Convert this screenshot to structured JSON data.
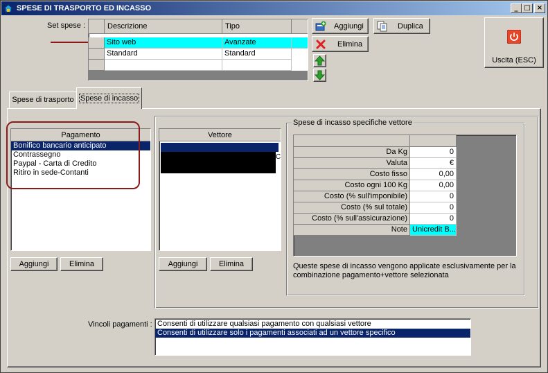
{
  "window": {
    "title": "SPESE DI TRASPORTO ED INCASSO",
    "min_label": "_",
    "max_label": "□",
    "close_label": "×"
  },
  "set_spese": {
    "label": "Set spese :",
    "columns": [
      "Descrizione",
      "Tipo"
    ],
    "rows": [
      {
        "descrizione": "Sito web",
        "tipo": "Avanzate"
      },
      {
        "descrizione": "Standard",
        "tipo": "Standard"
      },
      {
        "descrizione": "",
        "tipo": ""
      }
    ]
  },
  "toolbar": {
    "aggiungi": "Aggiungi",
    "duplica": "Duplica",
    "elimina": "Elimina",
    "uscita": "Uscita (ESC)"
  },
  "tabs": [
    {
      "label": "Spese di trasporto",
      "active": false
    },
    {
      "label": "Spese di incasso",
      "active": true
    }
  ],
  "pagamento": {
    "header": "Pagamento",
    "items": [
      "Bonifico bancario anticipato",
      "Contrassegno",
      "Paypal - Carta di Credito",
      "Ritiro in sede-Contanti"
    ],
    "selected_index": 0,
    "add_label": "Aggiungi",
    "delete_label": "Elimina"
  },
  "vettore": {
    "header": "Vettore",
    "add_label": "Aggiungi",
    "delete_label": "Elimina"
  },
  "spese_vettore": {
    "title": "Spese di incasso specifiche vettore",
    "rows": [
      {
        "label": "Da Kg",
        "value": "0"
      },
      {
        "label": "Valuta",
        "value": "€"
      },
      {
        "label": "Costo fisso",
        "value": "0,00"
      },
      {
        "label": "Costo ogni 100 Kg",
        "value": "0,00"
      },
      {
        "label": "Costo (% sull'imponibile)",
        "value": "0"
      },
      {
        "label": "Costo (% sul totale)",
        "value": "0"
      },
      {
        "label": "Costo (% sull'assicurazione)",
        "value": "0"
      },
      {
        "label": "Note",
        "value": "Unicredit B..."
      }
    ],
    "note_line1": "Queste spese di incasso vengono applicate esclusivamente per la",
    "note_line2": "combinazione pagamento+vettore selezionata"
  },
  "vincoli": {
    "label": "Vincoli pagamenti :",
    "options": [
      "Consenti di utilizzare qualsiasi pagamento con qualsiasi vettore",
      "Consenti di utilizzare solo i pagamenti associati ad un vettore specifico"
    ],
    "selected_index": 1
  },
  "colors": {
    "title_start": "#0a246a",
    "title_end": "#a6caf0",
    "selection": "#0a246a",
    "highlight_row": "#00ffff",
    "annotation": "#8b1a1a"
  },
  "icons": {
    "app": "app-icon",
    "aggiungi": "add-record-icon",
    "duplica": "duplicate-icon",
    "elimina": "delete-x-icon",
    "up": "arrow-up-icon",
    "down": "arrow-down-icon",
    "uscita": "power-icon"
  }
}
